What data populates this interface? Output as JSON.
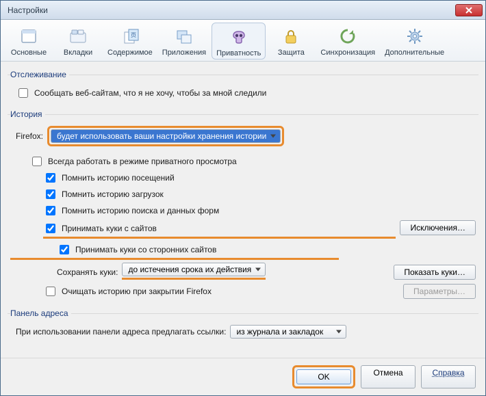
{
  "window": {
    "title": "Настройки"
  },
  "toolbar": {
    "items": [
      {
        "id": "general",
        "label": "Основные"
      },
      {
        "id": "tabs",
        "label": "Вкладки"
      },
      {
        "id": "content",
        "label": "Содержимое"
      },
      {
        "id": "applications",
        "label": "Приложения"
      },
      {
        "id": "privacy",
        "label": "Приватность"
      },
      {
        "id": "security",
        "label": "Защита"
      },
      {
        "id": "sync",
        "label": "Синхронизация"
      },
      {
        "id": "advanced",
        "label": "Дополнительные"
      }
    ],
    "active": "privacy"
  },
  "tracking": {
    "legend": "Отслеживание",
    "dnt_label": "Сообщать веб-сайтам, что я не хочу, чтобы за мной следили",
    "dnt_checked": false
  },
  "history": {
    "legend": "История",
    "firefox_label": "Firefox:",
    "mode_value": "будет использовать ваши настройки хранения истории",
    "always_private_label": "Всегда работать в режиме приватного просмотра",
    "always_private_checked": false,
    "remember_visits_label": "Помнить историю посещений",
    "remember_visits_checked": true,
    "remember_downloads_label": "Помнить историю загрузок",
    "remember_downloads_checked": true,
    "remember_forms_label": "Помнить историю поиска и данных форм",
    "remember_forms_checked": true,
    "accept_cookies_label": "Принимать куки с сайтов",
    "accept_cookies_checked": true,
    "exceptions_btn": "Исключения…",
    "third_party_label": "Принимать куки со сторонних сайтов",
    "third_party_checked": true,
    "keep_cookies_label": "Сохранять куки:",
    "keep_cookies_value": "до истечения срока их действия",
    "show_cookies_btn": "Показать куки…",
    "clear_on_close_label": "Очищать историю при закрытии Firefox",
    "clear_on_close_checked": false,
    "settings_btn": "Параметры…"
  },
  "locationbar": {
    "legend": "Панель адреса",
    "suggest_label": "При использовании панели адреса предлагать ссылки:",
    "suggest_value": "из журнала и закладок"
  },
  "footer": {
    "ok": "OK",
    "cancel": "Отмена",
    "help": "Справка"
  }
}
